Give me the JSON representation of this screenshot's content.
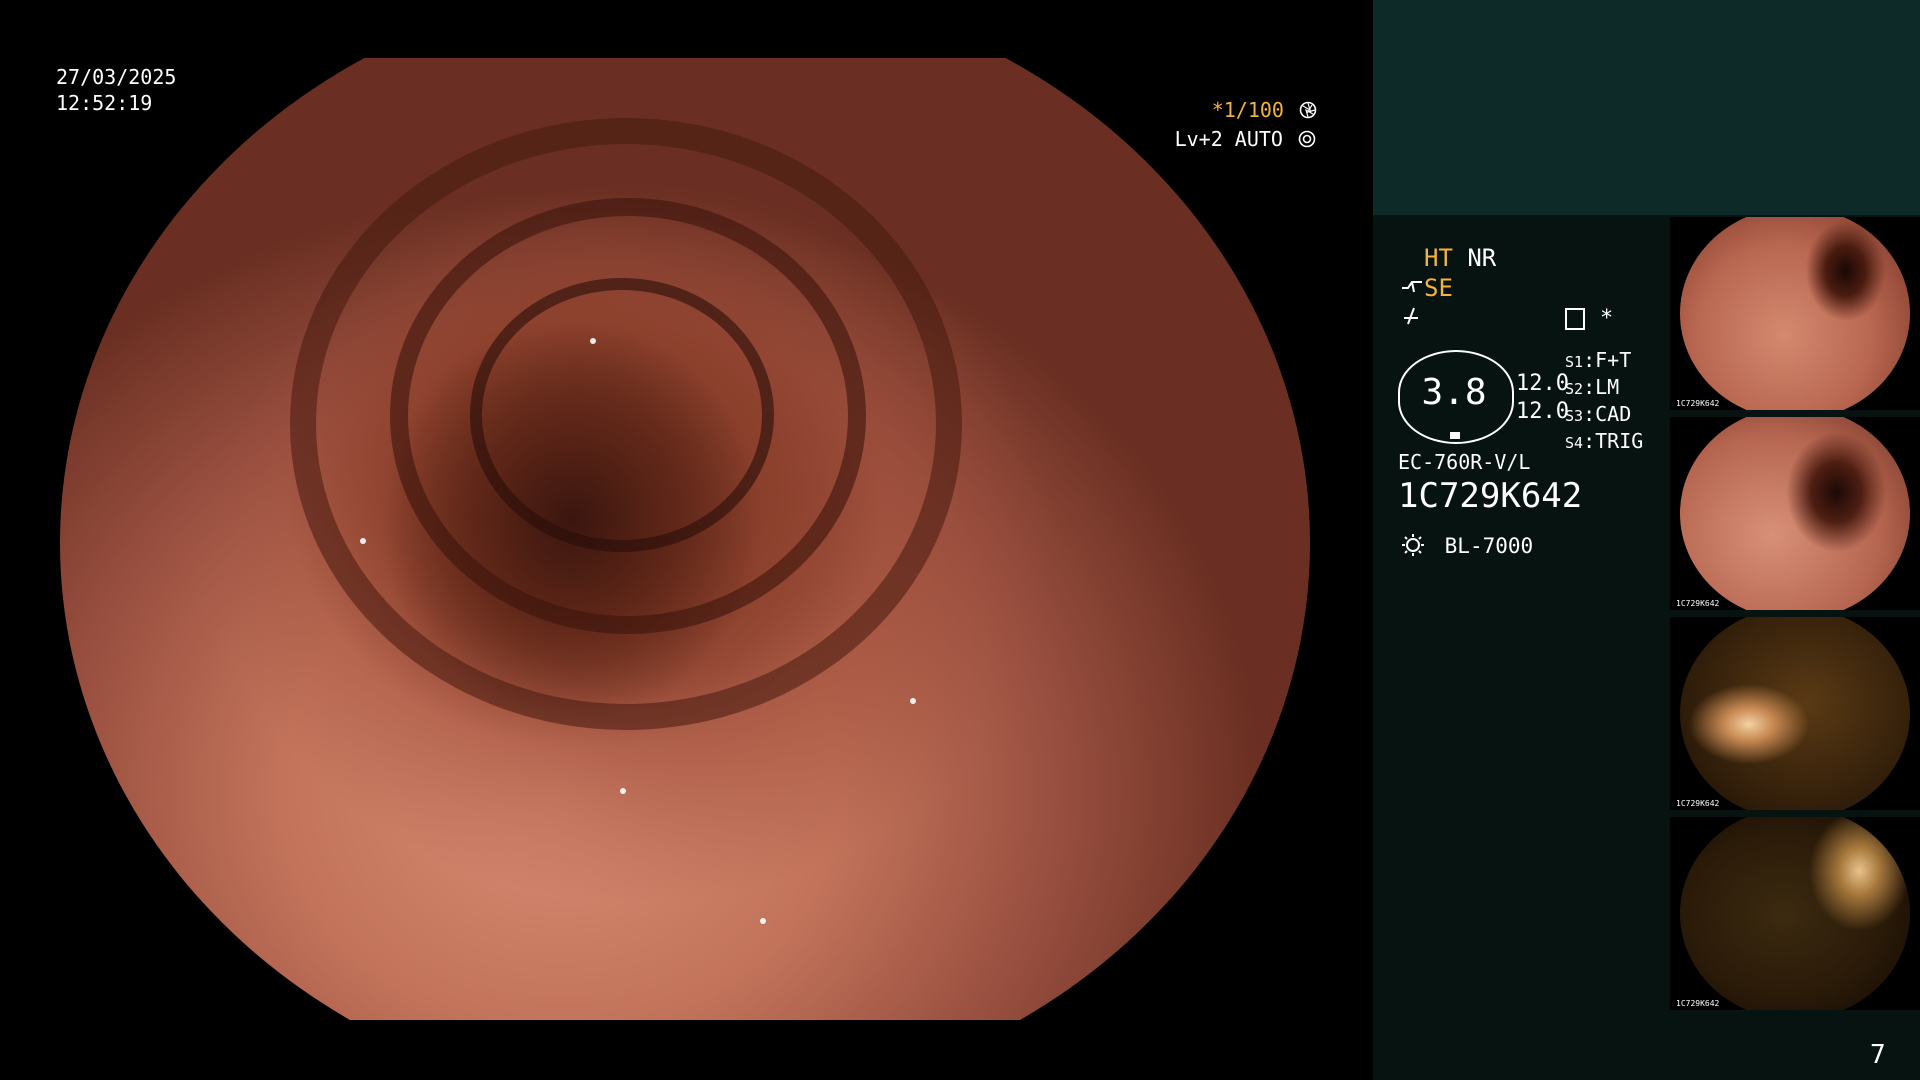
{
  "overlay": {
    "date": "27/03/2025",
    "time": "12:52:19",
    "shutter": "*1/100",
    "level_mode": "Lv+2 AUTO"
  },
  "panel": {
    "mode_ht": "HT",
    "mode_nr": "NR",
    "mode_se": "SE",
    "star": "*",
    "gauge_value": "3.8",
    "values": [
      "12.0",
      "12.0"
    ],
    "slots": [
      {
        "id": "S1",
        "label": "F+T"
      },
      {
        "id": "S2",
        "label": "LM"
      },
      {
        "id": "S3",
        "label": "CAD"
      },
      {
        "id": "S4",
        "label": "TRIG"
      }
    ],
    "scope_model": "EC-760R-V/L",
    "scope_serial": "1C729K642",
    "light_source": "BL-7000"
  },
  "thumbnails": [
    {
      "serial": "1C729K642"
    },
    {
      "serial": "1C729K642"
    },
    {
      "serial": "1C729K642"
    },
    {
      "serial": "1C729K642"
    }
  ],
  "icons": [
    "shutter-icon",
    "auto-iris-icon",
    "scope-icon",
    "freeze-icon",
    "document-icon",
    "lamp-icon"
  ],
  "page_number": "7"
}
